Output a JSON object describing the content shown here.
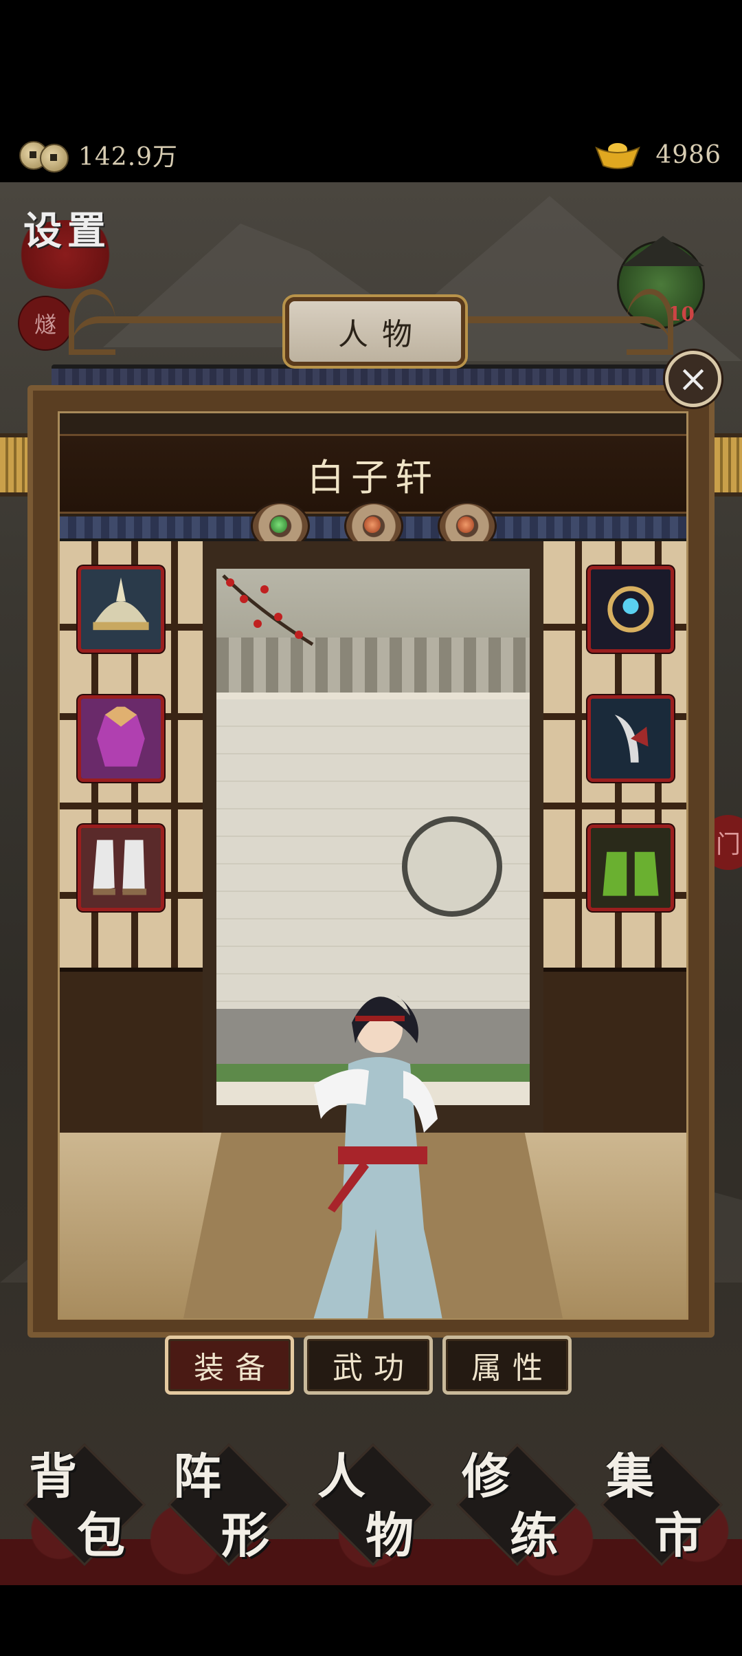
{
  "status_bar": {
    "coins": "142.9万",
    "ingots": "4986"
  },
  "side": {
    "settings_label": "设置",
    "lantern_label": "燧",
    "level": "10",
    "right_seal": "门"
  },
  "panel": {
    "title": "人物",
    "character_name": "白子轩",
    "equipment_left": [
      "helmet",
      "armor",
      "boots"
    ],
    "equipment_right": [
      "amulet",
      "weapon",
      "gloves"
    ]
  },
  "tabs": [
    {
      "label": "装备",
      "active": true
    },
    {
      "label": "武功",
      "active": false
    },
    {
      "label": "属性",
      "active": false
    }
  ],
  "nav": [
    {
      "c1": "背",
      "c2": "包"
    },
    {
      "c1": "阵",
      "c2": "形"
    },
    {
      "c1": "人",
      "c2": "物"
    },
    {
      "c1": "修",
      "c2": "练"
    },
    {
      "c1": "集",
      "c2": "市"
    }
  ],
  "colors": {
    "frame_red": "#9a1e1e",
    "wood": "#5a3e22",
    "text_light": "#efe3c6"
  }
}
